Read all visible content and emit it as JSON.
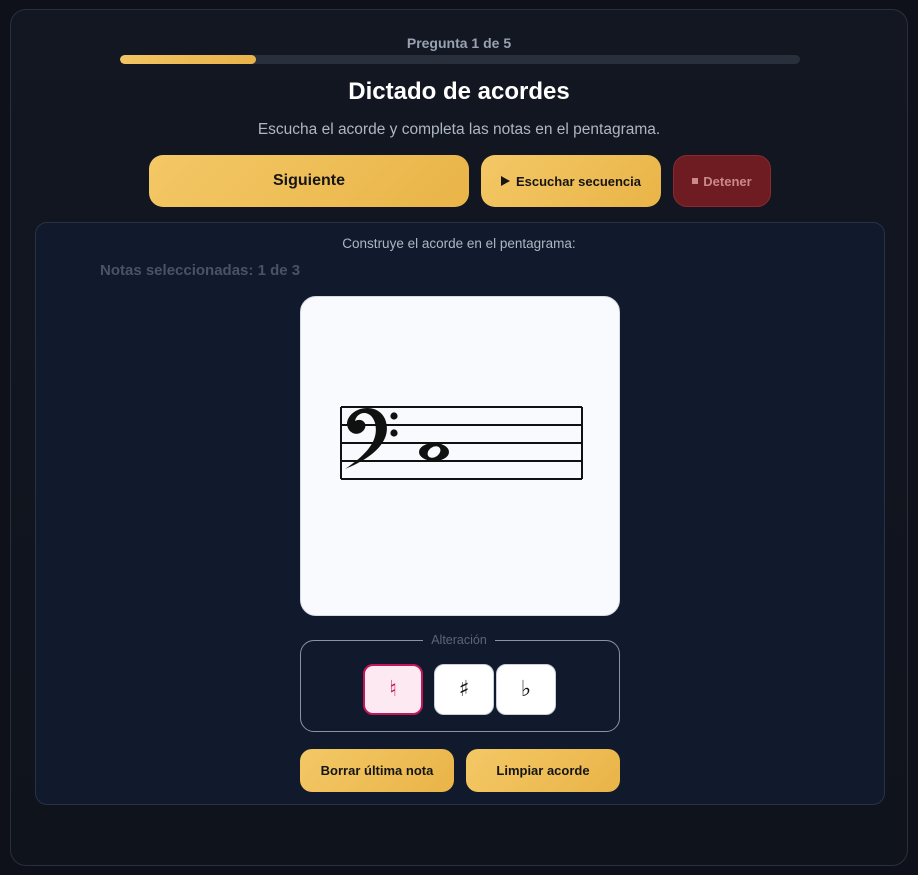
{
  "progress": {
    "label": "Pregunta 1 de 5",
    "fraction": 0.2
  },
  "header": {
    "title": "Dictado de acordes",
    "subtitle": "Escucha el acorde y completa las notas en el pentagrama."
  },
  "controls": {
    "next_label": "Siguiente",
    "listen_label": "Escuchar secuencia",
    "stop_label": "Detener"
  },
  "panel": {
    "caption": "Construye el acorde en el pentagrama:",
    "selected_notes": "Notas seleccionadas: 1 de 3"
  },
  "staff": {
    "clef": "bass-clef-icon",
    "notes": [
      "whole-note"
    ]
  },
  "alteration": {
    "legend": "Alteración",
    "options": [
      {
        "symbol": "♮",
        "name": "natural",
        "selected": true
      },
      {
        "symbol": "♯",
        "name": "sharp",
        "selected": false
      },
      {
        "symbol": "♭",
        "name": "flat",
        "selected": false
      }
    ]
  },
  "actions": {
    "erase_label": "Borrar última nota",
    "clear_label": "Limpiar acorde"
  },
  "colors": {
    "accent": "#f2c463",
    "stop": "#6e1b22",
    "selected_accidental": "#c2185b"
  }
}
